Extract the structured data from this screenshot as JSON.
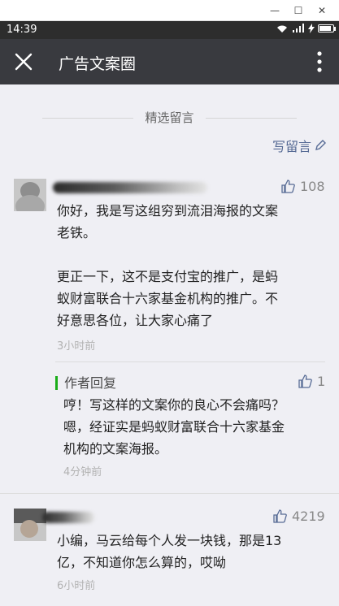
{
  "window": {
    "minimize": "—",
    "maximize": "☐",
    "close": "✕"
  },
  "status": {
    "time": "14:39",
    "battery_level": 0.85
  },
  "header": {
    "title": "广告文案圈"
  },
  "section": {
    "title": "精选留言",
    "write_label": "写留言"
  },
  "comments": [
    {
      "likes": "108",
      "lines": [
        "你好，我是写这组穷到流泪海报的文案",
        "老铁。",
        "",
        "更正一下，这不是支付宝的推广，是蚂",
        "蚁财富联合十六家基金机构的推广。不",
        "好意思各位，让大家心痛了"
      ],
      "time": "3小时前",
      "reply": {
        "label": "作者回复",
        "likes": "1",
        "lines": [
          "哼！写这样的文案你的良心不会痛吗？",
          "嗯，经证实是蚂蚁财富联合十六家基金",
          "机构的文案海报。"
        ],
        "time": "4分钟前"
      }
    },
    {
      "likes": "4219",
      "lines": [
        "小编，马云给每个人发一块钱，那是13",
        "亿，不知道你怎么算的，哎呦"
      ],
      "time": "6小时前"
    }
  ]
}
